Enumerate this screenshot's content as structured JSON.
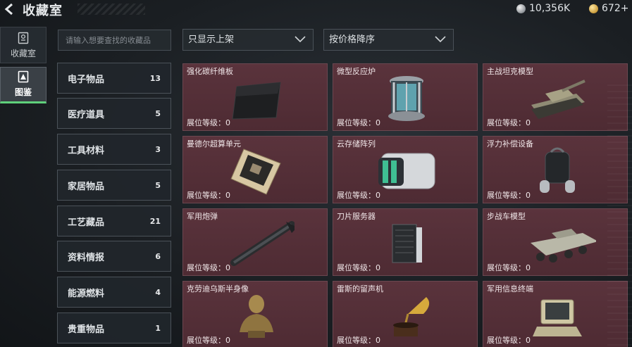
{
  "header": {
    "title": "收藏室",
    "currency_silver": "10,356K",
    "currency_gold": "672+"
  },
  "nav": {
    "tabs": [
      {
        "label": "收藏室",
        "icon": "collection-icon",
        "active": false
      },
      {
        "label": "图鉴",
        "icon": "codex-icon",
        "active": true
      }
    ]
  },
  "search": {
    "placeholder": "请输入想要查找的收藏品"
  },
  "filters": {
    "display": "只显示上架",
    "sort": "按价格降序"
  },
  "categories": [
    {
      "label": "电子物品",
      "count": "13"
    },
    {
      "label": "医疗道具",
      "count": "5"
    },
    {
      "label": "工具材料",
      "count": "3"
    },
    {
      "label": "家居物品",
      "count": "5"
    },
    {
      "label": "工艺藏品",
      "count": "21"
    },
    {
      "label": "资料情报",
      "count": "6"
    },
    {
      "label": "能源燃料",
      "count": "4"
    },
    {
      "label": "贵重物品",
      "count": "1"
    }
  ],
  "items": [
    {
      "name": "强化碳纤维板",
      "level": "展位等级：0"
    },
    {
      "name": "微型反应炉",
      "level": "展位等级：0"
    },
    {
      "name": "主战坦克模型",
      "level": "展位等级：0"
    },
    {
      "name": "曼德尔超算单元",
      "level": "展位等级：0"
    },
    {
      "name": "云存储阵列",
      "level": "展位等级：0"
    },
    {
      "name": "浮力补偿设备",
      "level": "展位等级：0"
    },
    {
      "name": "军用炮弹",
      "level": "展位等级：0"
    },
    {
      "name": "刀片服务器",
      "level": "展位等级：0"
    },
    {
      "name": "步战车模型",
      "level": "展位等级：0"
    },
    {
      "name": "克劳迪乌斯半身像",
      "level": "展位等级：0"
    },
    {
      "name": "雷斯的留声机",
      "level": "展位等级：0"
    },
    {
      "name": "军用信息终端",
      "level": "展位等级：0"
    }
  ]
}
